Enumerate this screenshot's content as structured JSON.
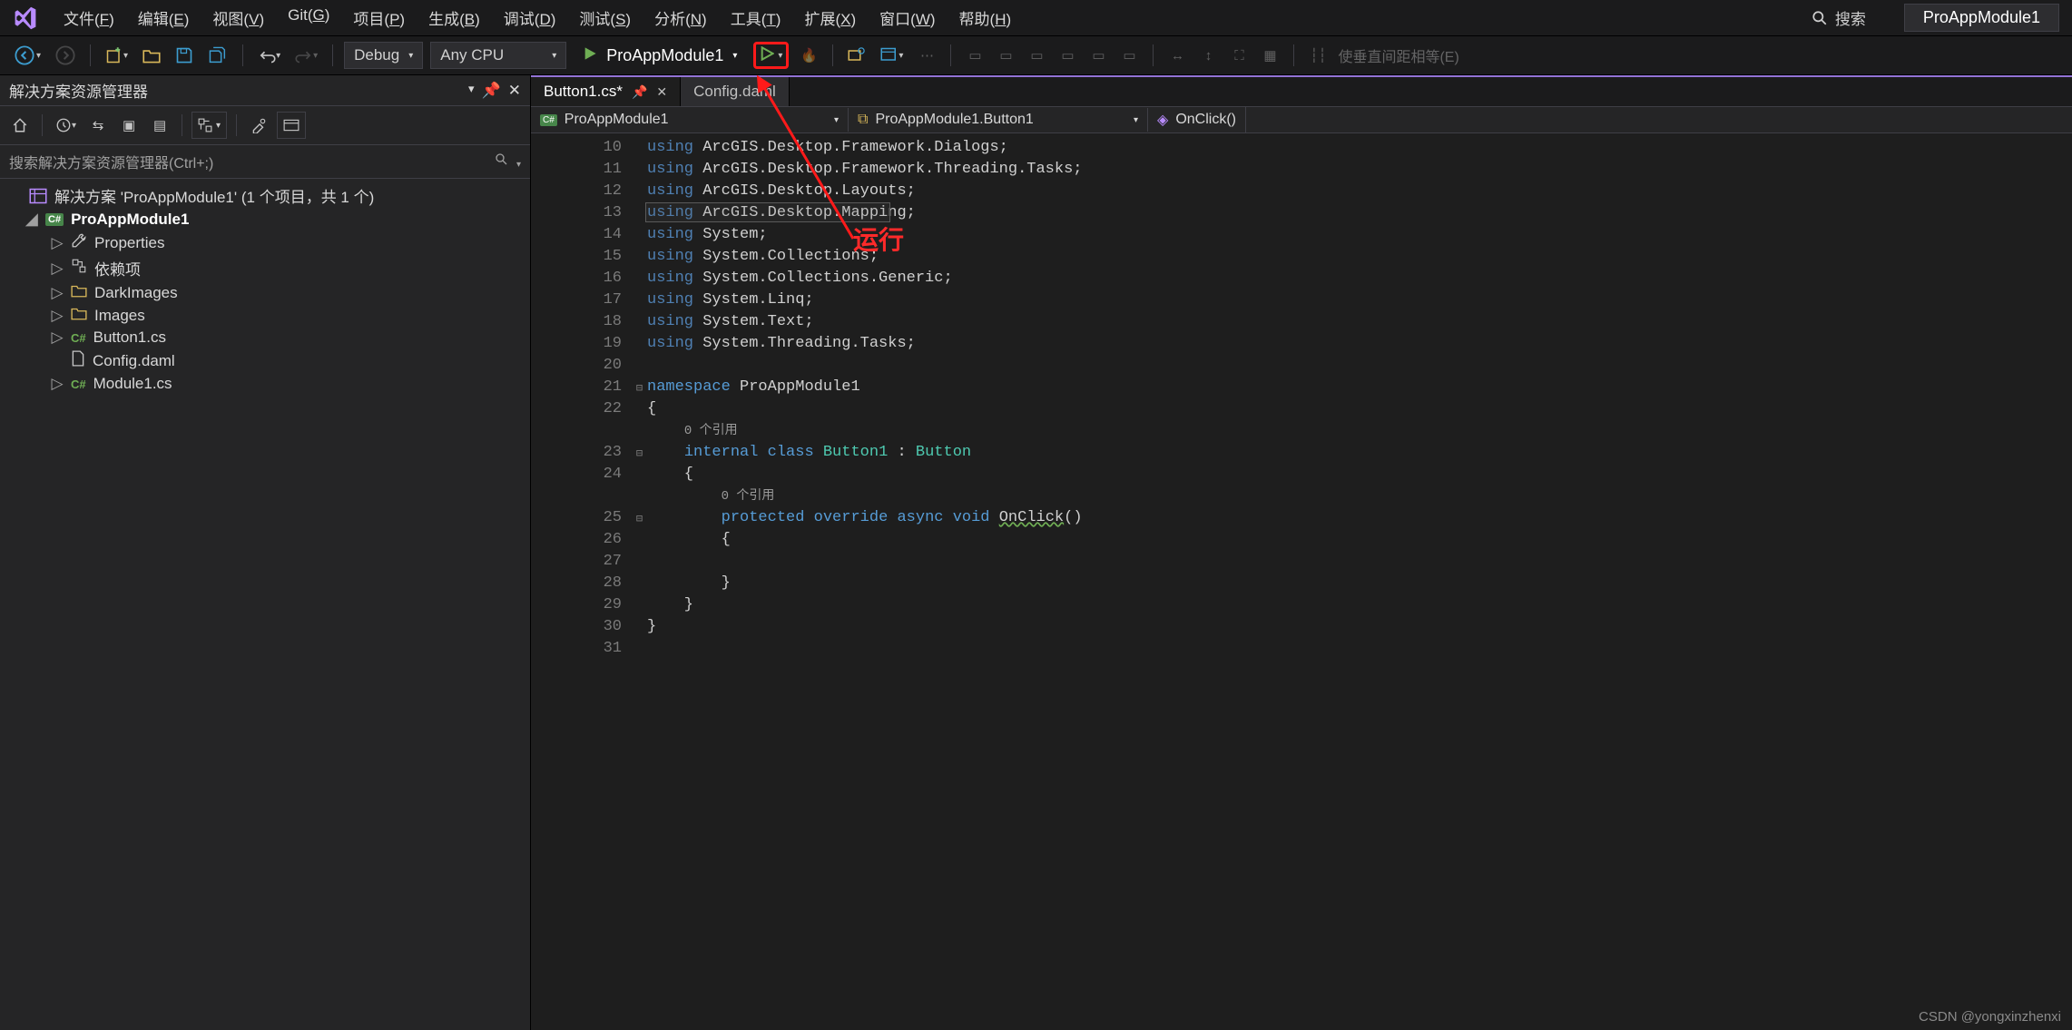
{
  "menubar": {
    "items": [
      {
        "label": "文件",
        "accel": "F"
      },
      {
        "label": "编辑",
        "accel": "E"
      },
      {
        "label": "视图",
        "accel": "V"
      },
      {
        "label": "Git",
        "accel": "G"
      },
      {
        "label": "项目",
        "accel": "P"
      },
      {
        "label": "生成",
        "accel": "B"
      },
      {
        "label": "调试",
        "accel": "D"
      },
      {
        "label": "测试",
        "accel": "S"
      },
      {
        "label": "分析",
        "accel": "N"
      },
      {
        "label": "工具",
        "accel": "T"
      },
      {
        "label": "扩展",
        "accel": "X"
      },
      {
        "label": "窗口",
        "accel": "W"
      },
      {
        "label": "帮助",
        "accel": "H"
      }
    ],
    "search_label": "搜索",
    "title": "ProAppModule1"
  },
  "toolbar": {
    "config": "Debug",
    "platform": "Any CPU",
    "run_target": "ProAppModule1",
    "align_label": "使垂直间距相等(E)"
  },
  "solution_explorer": {
    "title": "解决方案资源管理器",
    "search_placeholder": "搜索解决方案资源管理器(Ctrl+;)",
    "root": "解决方案 'ProAppModule1' (1 个项目，共 1 个)",
    "project": "ProAppModule1",
    "nodes": [
      {
        "label": "Properties",
        "icon": "wrench",
        "expand": true
      },
      {
        "label": "依赖项",
        "icon": "deps",
        "expand": true
      },
      {
        "label": "DarkImages",
        "icon": "folder",
        "expand": true
      },
      {
        "label": "Images",
        "icon": "folder",
        "expand": true
      },
      {
        "label": "Button1.cs",
        "icon": "cs",
        "expand": true
      },
      {
        "label": "Config.daml",
        "icon": "file",
        "expand": false
      },
      {
        "label": "Module1.cs",
        "icon": "cs",
        "expand": true
      }
    ]
  },
  "editor": {
    "tabs": [
      {
        "label": "Button1.cs*",
        "active": true,
        "pinned": false,
        "closable": true
      },
      {
        "label": "Config.daml",
        "active": false
      }
    ],
    "nav": {
      "scope": "ProAppModule1",
      "class": "ProAppModule1.Button1",
      "member": "OnClick()"
    },
    "first_line": 10,
    "lines": [
      {
        "n": 10,
        "html": "<span class='kw'>using</span> ArcGIS.Desktop.Framework.Dialogs;",
        "cut": true
      },
      {
        "n": 11,
        "html": "<span class='kw'>using</span> ArcGIS.Desktop.Framework.Threading.Tasks;"
      },
      {
        "n": 12,
        "html": "<span class='kw'>using</span> ArcGIS.Desktop.Layouts;"
      },
      {
        "n": 13,
        "html": "<span class='kw'>using</span> ArcGIS.Desktop.Mapping;",
        "outlined": true
      },
      {
        "n": 14,
        "html": "<span class='kw'>using</span> System;"
      },
      {
        "n": 15,
        "html": "<span class='kw'>using</span> System.Collections;"
      },
      {
        "n": 16,
        "html": "<span class='kw'>using</span> System.Collections.Generic;"
      },
      {
        "n": 17,
        "html": "<span class='kw'>using</span> System.Linq;"
      },
      {
        "n": 18,
        "html": "<span class='kw'>using</span> System.Text;"
      },
      {
        "n": 19,
        "html": "<span class='kw'>using</span> System.Threading.Tasks;"
      },
      {
        "n": 20,
        "html": ""
      },
      {
        "n": 21,
        "html": "<span class='kw2'>namespace</span> ProAppModule1",
        "fold": "-"
      },
      {
        "n": 22,
        "html": "{"
      },
      {
        "n": 23,
        "html": "    <span class='ref'>0 个引用</span>",
        "refline": true
      },
      {
        "n": 23,
        "html": "    <span class='kw2'>internal</span> <span class='kw2'>class</span> <span class='type'>Button1</span> : <span class='type'>Button</span>",
        "fold": "-",
        "realnum": 23
      },
      {
        "n": 24,
        "html": "    {"
      },
      {
        "n": 25,
        "html": "        <span class='ref'>0 个引用</span>",
        "refline": true
      },
      {
        "n": 25,
        "html": "        <span class='kw2'>protected</span> <span class='kw2'>override</span> <span class='kw2'>async</span> <span class='kw2'>void</span> <span class='ul'>OnClick</span>()",
        "fold": "-",
        "realnum": 25
      },
      {
        "n": 26,
        "html": "        {"
      },
      {
        "n": 27,
        "html": "        "
      },
      {
        "n": 28,
        "html": "        }"
      },
      {
        "n": 29,
        "html": "    }"
      },
      {
        "n": 30,
        "html": "}"
      },
      {
        "n": 31,
        "html": ""
      }
    ]
  },
  "annotation": {
    "text": "运行"
  },
  "watermark": "CSDN @yongxinzhenxi"
}
